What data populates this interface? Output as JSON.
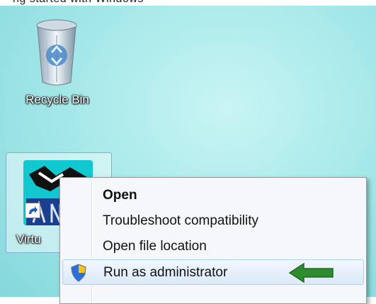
{
  "top_text": "ng started with Windows",
  "desktop": {
    "recycle_bin": {
      "label": "Recycle Bin"
    },
    "app_shortcut": {
      "label": "Virtu"
    }
  },
  "context_menu": {
    "items": [
      {
        "label": "Open",
        "bold": true
      },
      {
        "label": "Troubleshoot compatibility"
      },
      {
        "label": "Open file location"
      },
      {
        "label": "Run as administrator",
        "icon": "uac-shield-icon",
        "highlighted": true,
        "annotation": "green-arrow-icon"
      }
    ]
  },
  "colors": {
    "desktop_bg": "#a8e9ea",
    "menu_bg": "#f5f7fa",
    "highlight": "#dbe9fa",
    "arrow": "#2e8b2e"
  }
}
